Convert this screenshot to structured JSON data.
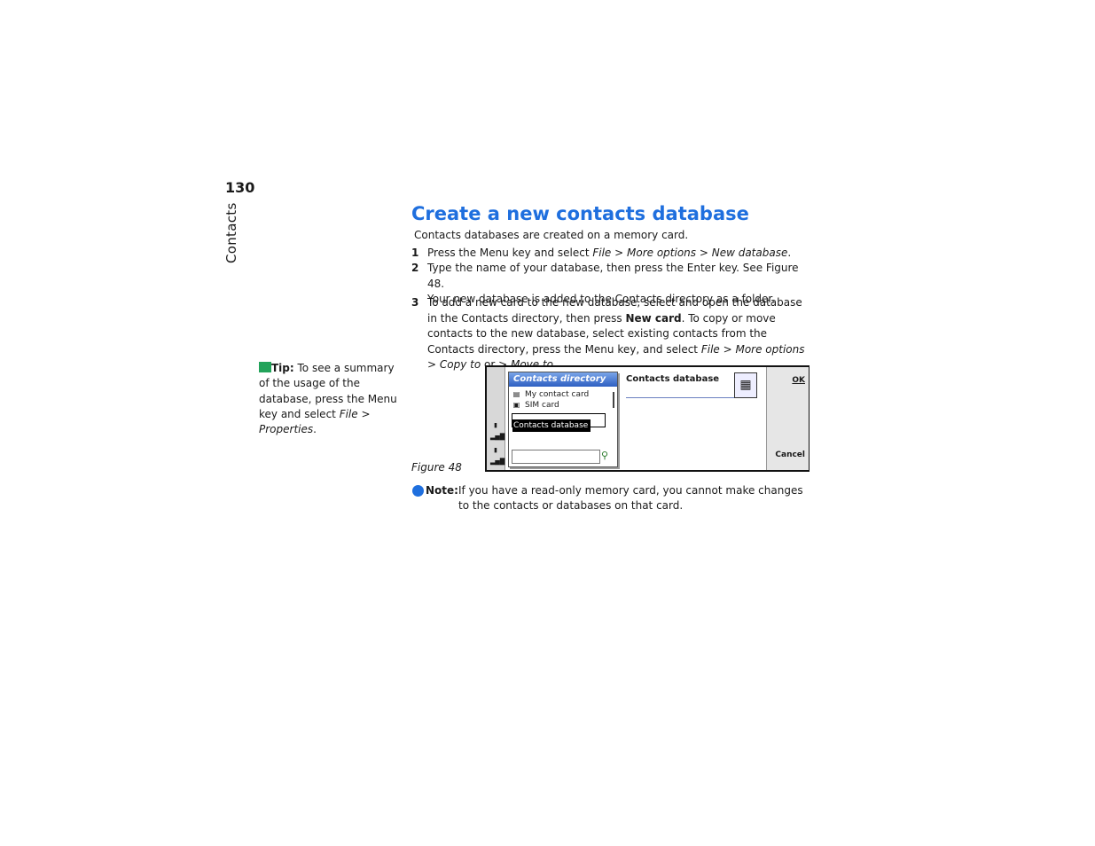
{
  "page": {
    "number": "130",
    "section": "Contacts"
  },
  "heading": "Create a new contacts database",
  "intro": "Contacts databases are created on a memory card.",
  "steps": [
    {
      "num": "1",
      "parts": [
        "Press the Menu key and select ",
        "File",
        " > ",
        "More options",
        " > ",
        "New database",
        "."
      ]
    },
    {
      "num": "2",
      "parts": [
        "Type the name of your database, then press the Enter key. See Figure 48.",
        "Your new database is added to the Contacts directory as a folder."
      ]
    },
    {
      "num": "3",
      "parts": [
        "To add a new card to the new database, select and open the database in the Contacts directory, then press ",
        "New card",
        ". To copy or move contacts to the new database, select existing contacts from the Contacts directory, press the Menu key, and select ",
        "File",
        " > ",
        "More options",
        " > ",
        "Copy to",
        " or > ",
        "Move to",
        "."
      ]
    }
  ],
  "tip": {
    "label": "Tip:",
    "text": " To see a summary of the usage of the database, press the Menu key and select ",
    "path_a": "File",
    "sep": " > ",
    "path_b": "Properties",
    "end": "."
  },
  "figure": {
    "caption": "Figure 48",
    "directory_title": "Contacts directory",
    "items": [
      "My contact card",
      "SIM card"
    ],
    "selected_item": "Contacts database",
    "form_title": "Contacts database",
    "ok_label": "OK",
    "cancel_label": "Cancel",
    "icons": {
      "card": "contact-card-icon",
      "sim": "sim-card-icon",
      "search": "search-icon",
      "database": "database-icon"
    }
  },
  "note": {
    "label": "Note:",
    "text": "If you have a read-only memory card, you cannot make changes to the contacts or databases on that card."
  },
  "colors": {
    "heading": "#1f6fde",
    "tip_icon": "#22a35a",
    "note_icon": "#1f6fde"
  }
}
